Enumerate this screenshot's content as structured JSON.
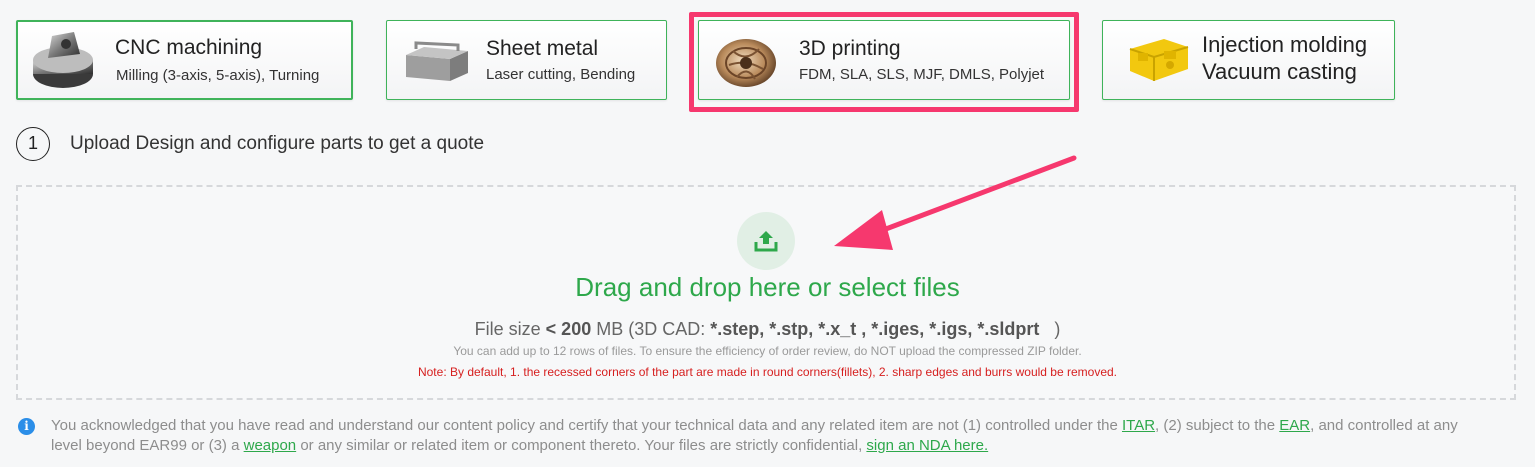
{
  "services": [
    {
      "title": "CNC machining",
      "subtitle": "Milling (3-axis, 5-axis), Turning",
      "thumb": "cnc-part-thumbnail"
    },
    {
      "title": "Sheet metal",
      "subtitle": "Laser cutting, Bending",
      "thumb": "sheet-metal-thumbnail"
    },
    {
      "title": "3D printing",
      "subtitle": "FDM, SLA, SLS, MJF, DMLS, Polyjet",
      "thumb": "3d-print-thumbnail"
    },
    {
      "title": "Injection molding",
      "subtitle": "Vacuum casting",
      "thumb": "injection-mold-thumbnail"
    }
  ],
  "step": {
    "number": "1",
    "text": "Upload Design and configure parts to get a quote"
  },
  "dropzone": {
    "icon": "upload-icon",
    "title": "Drag and drop here or select files",
    "size_prefix": "File size ",
    "size_lt": "< 200",
    "size_unit": " MB (3D CAD: ",
    "formats": "*.step, *.stp, *.x_t , *.iges, *.igs, *.sldprt",
    "size_suffix": "   )",
    "hint": "You can add up to 12 rows of files. To ensure the efficiency of order review, do NOT upload the compressed ZIP folder.",
    "note": "Note: By default, 1. the recessed corners of the part are made in round corners(fillets), 2. sharp edges and burrs would be removed."
  },
  "acknowledgement": {
    "icon": "info-icon",
    "part1": "You acknowledged that you have read and understand our content policy and certify that your technical data and any related item are not (1) controlled under the ",
    "link_itar": "ITAR",
    "part2": ", (2) subject to the ",
    "link_ear": "EAR",
    "part3": ", and controlled at any level beyond EAR99 or (3) a ",
    "link_weapon": "weapon",
    "part4": " or any similar or related item or component thereto. Your files are strictly confidential, ",
    "link_nda": "sign an NDA here."
  },
  "colors": {
    "accent_green": "#2ea84b",
    "card_border": "#3fb35a",
    "highlight_pink": "#f6386e",
    "note_red": "#d61f1f",
    "info_blue": "#2b8ee8"
  }
}
